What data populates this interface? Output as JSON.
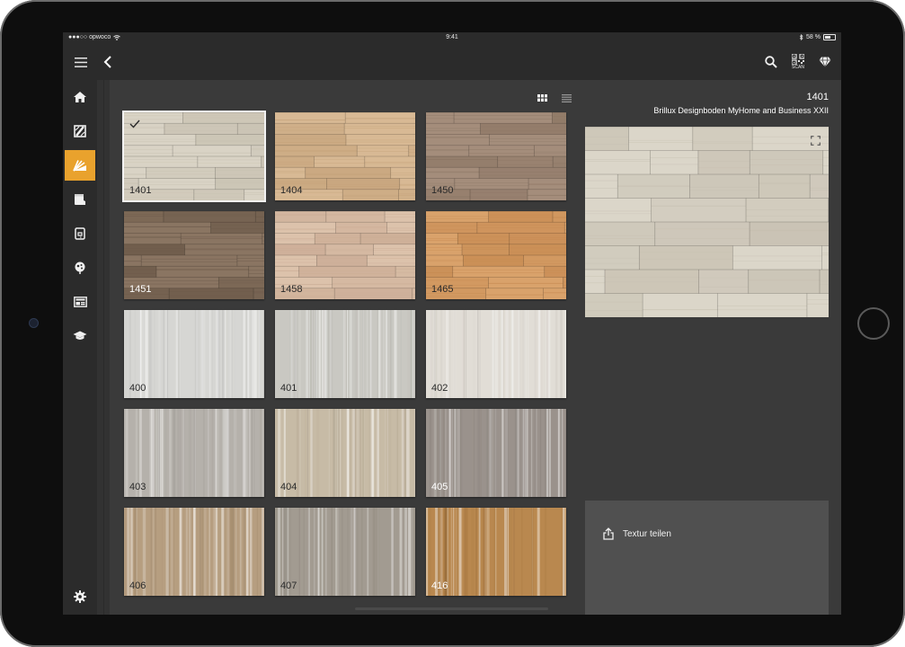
{
  "statusbar": {
    "carrier": "●●●○○ opwoco",
    "time": "9:41",
    "battery": "58 %"
  },
  "topbar": {
    "menu_icon": "menu-icon",
    "back_icon": "chevron-left-icon",
    "search_icon": "search-icon",
    "scan_icon": "qr-scan-icon",
    "scan_label": "SCAN",
    "premium_icon": "diamond-icon"
  },
  "sidebar": {
    "items": [
      {
        "icon": "home-icon",
        "active": false
      },
      {
        "icon": "wall-brush-icon",
        "active": false
      },
      {
        "icon": "floor-swatches-icon",
        "active": true
      },
      {
        "icon": "paint-bucket-icon",
        "active": false
      },
      {
        "icon": "device-sync-icon",
        "active": false
      },
      {
        "icon": "palette-leaf-icon",
        "active": false
      },
      {
        "icon": "layout-icon",
        "active": false
      },
      {
        "icon": "graduation-cap-icon",
        "active": false
      }
    ],
    "settings_icon": "gear-icon"
  },
  "view_toggle": {
    "grid_icon": "grid-view-icon",
    "list_icon": "list-view-icon",
    "active": "grid"
  },
  "textures": [
    {
      "code": "1401",
      "style": "plank",
      "colors": [
        "#d9d3c5",
        "#c8c1b1"
      ],
      "label_color": "#2a2a2a",
      "selected": true
    },
    {
      "code": "1404",
      "style": "plank",
      "colors": [
        "#d8b994",
        "#c4a179"
      ],
      "label_color": "#2a2a2a",
      "selected": false
    },
    {
      "code": "1450",
      "style": "plank",
      "colors": [
        "#a48d7b",
        "#8c7664"
      ],
      "label_color": "#2a2a2a",
      "selected": false
    },
    {
      "code": "1451",
      "style": "plank",
      "colors": [
        "#8a7562",
        "#6c5a4a"
      ],
      "label_color": "#ffffff",
      "selected": false
    },
    {
      "code": "1458",
      "style": "plank",
      "colors": [
        "#dcc2ab",
        "#caab94"
      ],
      "label_color": "#2a2a2a",
      "selected": false
    },
    {
      "code": "1465",
      "style": "plank",
      "colors": [
        "#d9a26b",
        "#c68a52"
      ],
      "label_color": "#2a2a2a",
      "selected": false
    },
    {
      "code": "400",
      "style": "grain",
      "colors": [
        "#d6d6d3",
        "#c4c4c1"
      ],
      "label_color": "#2a2a2a",
      "selected": false
    },
    {
      "code": "401",
      "style": "grain",
      "colors": [
        "#c9c8c2",
        "#b6b5ae"
      ],
      "label_color": "#2a2a2a",
      "selected": false
    },
    {
      "code": "402",
      "style": "grain",
      "colors": [
        "#e1ddd6",
        "#d2cdc5"
      ],
      "label_color": "#2a2a2a",
      "selected": false
    },
    {
      "code": "403",
      "style": "grain",
      "colors": [
        "#b5b1ab",
        "#a19d97"
      ],
      "label_color": "#2a2a2a",
      "selected": false
    },
    {
      "code": "404",
      "style": "grain",
      "colors": [
        "#c7bba6",
        "#b3a690"
      ],
      "label_color": "#2a2a2a",
      "selected": false
    },
    {
      "code": "405",
      "style": "grain",
      "colors": [
        "#9a928c",
        "#857d77"
      ],
      "label_color": "#ffffff",
      "selected": false
    },
    {
      "code": "406",
      "style": "grain",
      "colors": [
        "#b69e80",
        "#9f8668"
      ],
      "label_color": "#2a2a2a",
      "selected": false
    },
    {
      "code": "407",
      "style": "grain",
      "colors": [
        "#a29b91",
        "#8c857b"
      ],
      "label_color": "#2a2a2a",
      "selected": false
    },
    {
      "code": "416",
      "style": "grain",
      "colors": [
        "#b9884f",
        "#a0723d"
      ],
      "label_color": "#ffffff",
      "selected": false
    }
  ],
  "detail": {
    "code": "1401",
    "title": "Brillux Designboden MyHome and Business XXII",
    "preview_colors": [
      "#dbd6c9",
      "#c6bfb0"
    ],
    "expand_icon": "expand-icon"
  },
  "share": {
    "icon": "share-icon",
    "label": "Textur teilen"
  }
}
